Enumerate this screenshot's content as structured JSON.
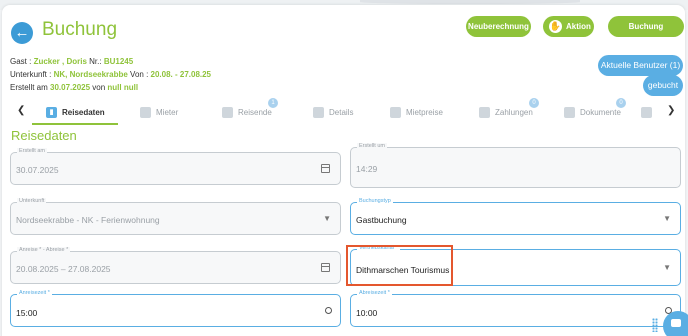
{
  "header": {
    "title": "Buchung",
    "buttons": {
      "neuberechnung": "Neuberechnung",
      "aktion": "Aktion",
      "buchung_abrechnen": "Buchung abrechnen",
      "aktuelle_benutzer": "Aktuelle Benutzer (1)",
      "gebucht": "gebucht"
    }
  },
  "info": {
    "gast_label": "Gast : ",
    "gast_name": "Zucker , Doris",
    "nr_label": " Nr.: ",
    "nr_value": "BU1245",
    "unterkunft_label": "Unterkunft : ",
    "unterkunft_value": "NK, Nordseekrabbe",
    "von_label": " Von : ",
    "von_value": "20.08. - 27.08.25",
    "erstellt_label": "Erstellt am ",
    "erstellt_value": "30.07.2025",
    "von2_label": " von ",
    "von2_value": "null null"
  },
  "tabs": [
    {
      "label": "Reisedaten",
      "icon": "suitcase-icon",
      "badge": ""
    },
    {
      "label": "Mieter",
      "icon": "person-icon",
      "badge": ""
    },
    {
      "label": "Reisende",
      "icon": "people-icon",
      "badge": "1"
    },
    {
      "label": "Details",
      "icon": "list-icon",
      "badge": ""
    },
    {
      "label": "Mietpreise",
      "icon": "price-icon",
      "badge": ""
    },
    {
      "label": "Zahlungen",
      "icon": "payment-icon",
      "badge": "0"
    },
    {
      "label": "Dokumente",
      "icon": "document-icon",
      "badge": "0"
    },
    {
      "label": "",
      "icon": "messages-icon",
      "badge": ""
    }
  ],
  "section_title": "Reisedaten",
  "fields": {
    "erstellt_am": {
      "label": "Erstellt am",
      "value": "30.07.2025"
    },
    "erstellt_um": {
      "label": "Erstellt um",
      "value": "14:29"
    },
    "unterkunft": {
      "label": "Unterkunft",
      "value": "Nordseekrabbe - NK - Ferienwohnung"
    },
    "buchungstyp": {
      "label": "Buchungstyp",
      "value": "Gastbuchung"
    },
    "anreise_abreise": {
      "label": "Anreise * - Abreise *",
      "value": "20.08.2025 – 27.08.2025"
    },
    "vertriebskanal": {
      "label": "Vertriebskanal *",
      "value": "Dithmarschen Tourismus"
    },
    "anreisezeit": {
      "label": "Anreisezeit *",
      "value": "15:00"
    },
    "abreisezeit": {
      "label": "Abreisezeit *",
      "value": "10:00"
    }
  },
  "colors": {
    "accent_green": "#8fc33a",
    "accent_blue": "#5aaee3",
    "highlight": "#e4572e"
  }
}
